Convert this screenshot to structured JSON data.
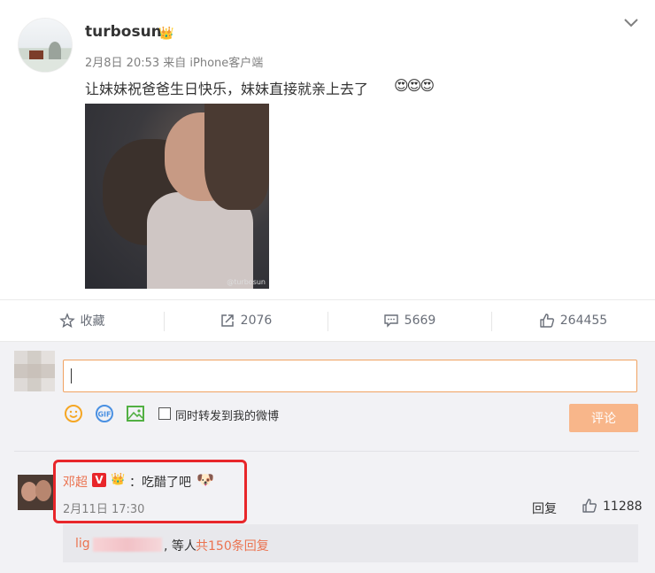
{
  "post": {
    "username": "turbosun",
    "meta": "2月8日 20:53 来自 iPhone客户端",
    "text": "让妹妹祝爸爸生日快乐，妹妹直接就亲上去了",
    "emojis": "😍😍😍",
    "image_watermark": "@turbosun",
    "badge_icon": "crown-icon"
  },
  "actions": {
    "favorite": {
      "label": "收藏",
      "icon": "star-icon"
    },
    "repost": {
      "label": "2076",
      "icon": "share-icon"
    },
    "comment": {
      "label": "5669",
      "icon": "comment-icon"
    },
    "like": {
      "label": "264455",
      "icon": "thumbs-up-icon"
    }
  },
  "composer": {
    "placeholder": "",
    "repost_label": "同时转发到我的微博",
    "submit_label": "评论",
    "tools": [
      "smile-icon",
      "gif-icon",
      "image-icon"
    ]
  },
  "comment": {
    "name": "邓超",
    "text": "：吃醋了吧",
    "emoji": "🐶",
    "time": "2月11日 17:30",
    "reply_label": "回复",
    "like_count": "11288",
    "reply_preview": {
      "user": "lig",
      "suffix": ", 等人",
      "total": "共150条回复"
    }
  },
  "colors": {
    "accent": "#eb7350",
    "input_border": "#f0a261",
    "submit_bg": "#f8b68a",
    "highlight": "#e8262a"
  }
}
